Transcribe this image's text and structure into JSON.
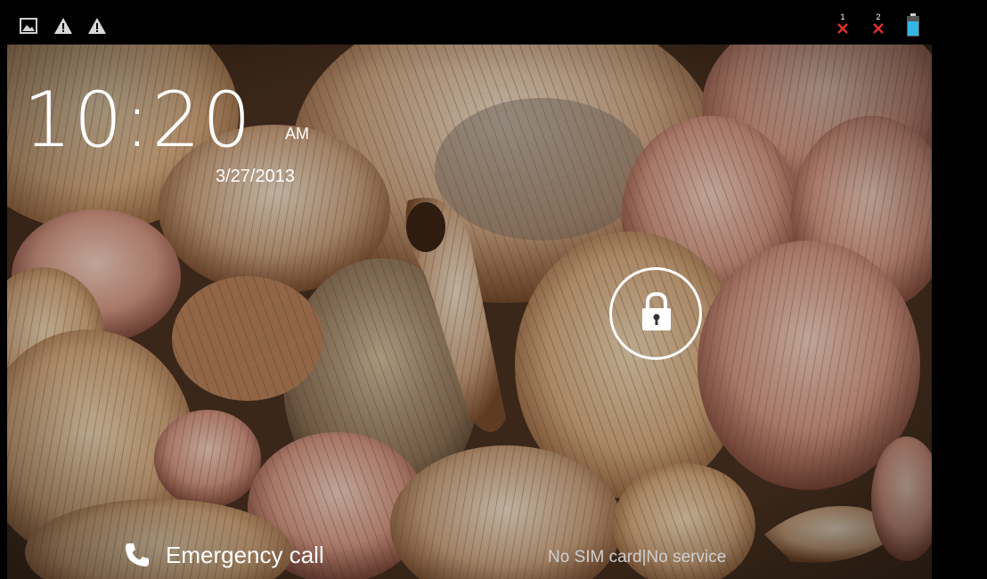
{
  "status_bar": {
    "left_icons": [
      "gallery-icon",
      "warning-icon",
      "warning-icon"
    ],
    "right_icons": [
      {
        "name": "sim-1-no-signal-icon",
        "label": "1"
      },
      {
        "name": "sim-2-no-signal-icon",
        "label": "2"
      },
      {
        "name": "battery-icon"
      }
    ],
    "colors": {
      "no_signal": "#e03030",
      "battery": "#33b5e5"
    }
  },
  "lockscreen": {
    "time": "10:20",
    "ampm": "AM",
    "date": "3/27/2013",
    "emergency_label": "Emergency call",
    "carrier_text": "No SIM card|No service",
    "lock_icon": "padlock-icon"
  }
}
